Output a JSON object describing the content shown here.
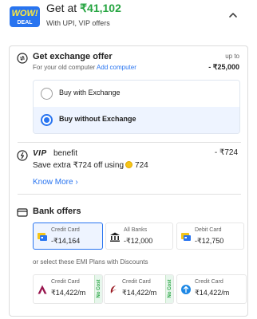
{
  "header": {
    "badge_top": "WOW!",
    "badge_bottom": "DEAL",
    "get_at_label": "Get at",
    "price": "₹41,102",
    "subtitle": "With UPI, VIP offers"
  },
  "exchange": {
    "title": "Get exchange offer",
    "subtitle": "For your old computer",
    "add_link": "Add computer",
    "upto_label": "up to",
    "upto_value": "- ₹25,000",
    "options": [
      {
        "label": "Buy with Exchange",
        "selected": false
      },
      {
        "label": "Buy without Exchange",
        "selected": true
      }
    ]
  },
  "vip": {
    "logo": "VIP",
    "benefit": "benefit",
    "amount": "- ₹724",
    "extra_text": "Save extra ₹724 off using",
    "coins": "724",
    "know_more": "Know More ›"
  },
  "bank_offers": {
    "title": "Bank offers",
    "cards": [
      {
        "label": "Credit Card",
        "value": "-₹14,164",
        "icon": "card-icon",
        "selected": true
      },
      {
        "label": "All Banks",
        "value": "-₹12,000",
        "icon": "bank-icon",
        "selected": false
      },
      {
        "label": "Debit Card",
        "value": "-₹12,750",
        "icon": "card-icon",
        "selected": false
      }
    ],
    "emi_intro": "or select these EMI Plans with Discounts",
    "emi_plans": [
      {
        "label": "Credit Card",
        "value": "₹14,422/m",
        "badge": "No Cost",
        "icon": "axis-bank-icon"
      },
      {
        "label": "Credit Card",
        "value": "₹14,422/m",
        "badge": "No Cost",
        "icon": "idfc-bank-icon"
      },
      {
        "label": "Credit Card",
        "value": "₹14,422/m",
        "badge": "",
        "icon": "bank-logo-icon"
      }
    ]
  },
  "colors": {
    "accent": "#2874f0",
    "price_green": "#26a541",
    "selected_bg": "#eef4ff"
  }
}
